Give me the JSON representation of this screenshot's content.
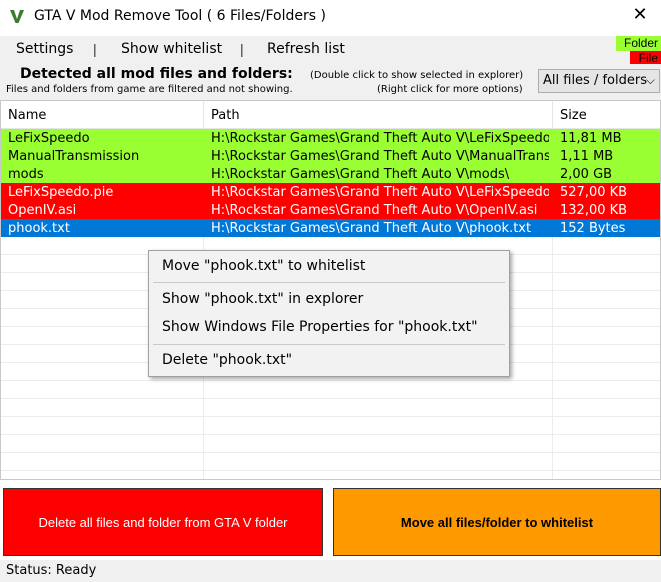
{
  "window": {
    "title": "GTA V Mod Remove Tool ( 6 Files/Folders )",
    "close_glyph": "✕",
    "icon": "app-logo-icon"
  },
  "menu": {
    "settings": "Settings",
    "show_whitelist": "Show whitelist",
    "refresh_list": "Refresh list",
    "separator": "|"
  },
  "legend": {
    "folder_label": "Folder",
    "file_label": "File",
    "folder_color": "#99ff33",
    "file_color": "#ff0000"
  },
  "info": {
    "title": "Detected all mod files and folders:",
    "filtered_note": "Files and folders from game are filtered and not showing.",
    "hint_double": "(Double click to show selected in explorer)",
    "hint_right": "(Right click for more options)"
  },
  "filter": {
    "selected": "All files / folders",
    "chevron": "⌵"
  },
  "table": {
    "headers": {
      "name": "Name",
      "path": "Path",
      "size": "Size"
    },
    "rows": [
      {
        "name": "LeFixSpeedo",
        "path": "H:\\Rockstar Games\\Grand Theft Auto V\\LeFixSpeedo\\",
        "size": "11,81 MB",
        "type": "folder",
        "bg": "#99ff33",
        "fg": "#000000"
      },
      {
        "name": "ManualTransmission",
        "path": "H:\\Rockstar Games\\Grand Theft Auto V\\ManualTrans...",
        "size": "1,11 MB",
        "type": "folder",
        "bg": "#99ff33",
        "fg": "#000000"
      },
      {
        "name": "mods",
        "path": "H:\\Rockstar Games\\Grand Theft Auto V\\mods\\",
        "size": "2,00 GB",
        "type": "folder",
        "bg": "#99ff33",
        "fg": "#000000"
      },
      {
        "name": "LeFixSpeedo.pie",
        "path": "H:\\Rockstar Games\\Grand Theft Auto V\\LeFixSpeedo...",
        "size": "527,00 KB",
        "type": "file",
        "bg": "#ff0000",
        "fg": "#ffffff"
      },
      {
        "name": "OpenIV.asi",
        "path": "H:\\Rockstar Games\\Grand Theft Auto V\\OpenIV.asi",
        "size": "132,00 KB",
        "type": "file",
        "bg": "#ff0000",
        "fg": "#ffffff"
      },
      {
        "name": "phook.txt",
        "path": "H:\\Rockstar Games\\Grand Theft Auto V\\phook.txt",
        "size": "152 Bytes",
        "type": "file-selected",
        "bg": "#0078d7",
        "fg": "#ffffff"
      }
    ]
  },
  "context_menu": {
    "move_to_whitelist": "Move \"phook.txt\" to whitelist",
    "show_in_explorer": "Show \"phook.txt\" in explorer",
    "show_properties": "Show Windows File Properties for \"phook.txt\"",
    "delete": "Delete \"phook.txt\""
  },
  "buttons": {
    "delete_all": "Delete all files and folder from GTA V folder",
    "move_all": "Move all files/folder to whitelist"
  },
  "status": {
    "text": "Status: Ready"
  }
}
